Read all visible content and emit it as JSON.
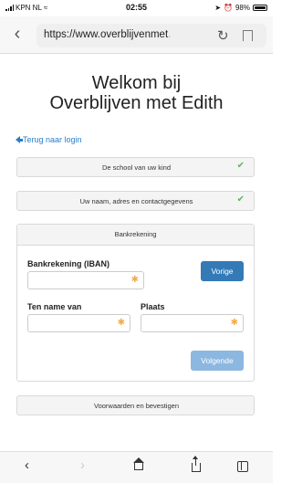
{
  "status_bar": {
    "carrier": "KPN NL",
    "time": "02:55",
    "battery": "98%"
  },
  "browser": {
    "url_visible": "https://www.overblijvenmet",
    "url_faded": "."
  },
  "page": {
    "title_line1": "Welkom bij",
    "title_line2": "Overblijven met Edith",
    "back_link": "Terug naar login",
    "steps": {
      "school": "De school van uw kind",
      "contact": "Uw naam, adres en contactgegevens",
      "bank": "Bankrekening",
      "terms": "Voorwaarden en bevestigen"
    },
    "form": {
      "iban_label": "Bankrekening (IBAN)",
      "name_label": "Ten name van",
      "city_label": "Plaats",
      "required_marker": "✱",
      "prev_button": "Vorige",
      "next_button": "Volgende"
    }
  },
  "colors": {
    "link": "#2a7fc8",
    "check": "#5cb85c",
    "required": "#f0ad4e",
    "primary": "#337ab7",
    "primary_disabled": "#8cb7e0"
  }
}
